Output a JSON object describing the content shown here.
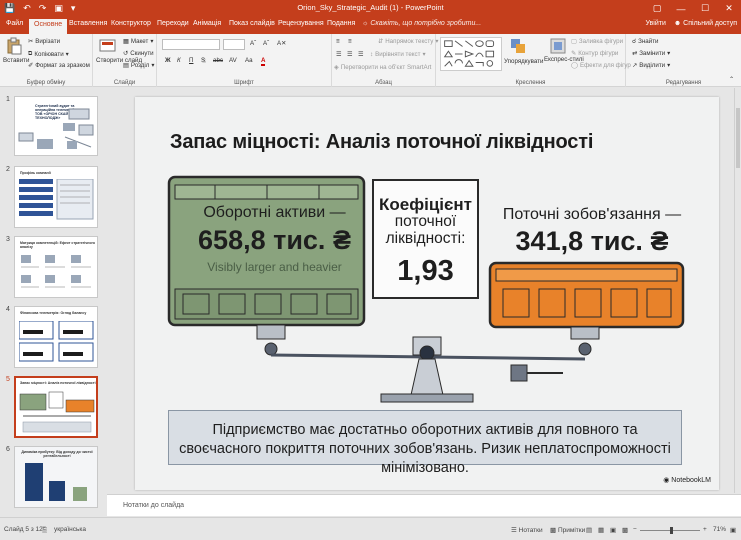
{
  "window": {
    "title": "Orion_Sky_Strategic_Audit (1) - PowerPoint",
    "controls": [
      "—",
      "☐",
      "✕"
    ]
  },
  "tabs": {
    "file": "Файл",
    "home": "Основне",
    "insert": "Вставлення",
    "design": "Конструктор",
    "transitions": "Переходи",
    "animations": "Анімація",
    "slideshow": "Показ слайдів",
    "review": "Рецензування",
    "view": "Подання",
    "tellme": "Скажіть, що потрібно зробити...",
    "signin": "Увійти",
    "share": "Спільний доступ"
  },
  "ribbon": {
    "clipboard": {
      "paste": "Вставити",
      "cut": "Вирізати",
      "copy": "Копіювати",
      "format_painter": "Формат за зразком",
      "label": "Буфер обміну"
    },
    "slides": {
      "new_slide": "Створити слайд",
      "layout": "Макет",
      "reset": "Скинути",
      "section": "Розділ",
      "label": "Слайди"
    },
    "font": {
      "label": "Шрифт",
      "buttons": [
        "Ж",
        "К",
        "П",
        "S",
        "abc",
        "AV",
        "Aa",
        "A"
      ]
    },
    "paragraph": {
      "text_direction": "Напрямок тексту",
      "align_text": "Вирівняти текст",
      "smartart": "Перетворити на об'єкт SmartArt",
      "label": "Абзац"
    },
    "drawing": {
      "arrange": "Упорядкувати",
      "quick_styles": "Експрес-стилі",
      "fill": "Заливка фігури",
      "outline": "Контур фігури",
      "effects": "Ефекти для фігур",
      "label": "Креслення"
    },
    "editing": {
      "find": "Знайти",
      "replace": "Замінити",
      "select": "Виділити",
      "label": "Редагування"
    }
  },
  "thumbnails": [
    {
      "number": "1",
      "text": "Стратегічний аудит та операційна телеметрія: ТОВ «ОРІОН СКАЙ ТЕХНОЛОДЖ»"
    },
    {
      "number": "2",
      "text": "Профіль компанії"
    },
    {
      "number": "3",
      "text": "Матриця компетенцій: Ефект стратегічного аналізу"
    },
    {
      "number": "4",
      "text": "Фінансова телеметрія: Огляд балансу"
    },
    {
      "number": "5",
      "text": "Запас міцності: Аналіз поточної ліквідності"
    },
    {
      "number": "6",
      "text": "Динаміка прибутку: Від доходу до чистої рентабельності"
    }
  ],
  "slide": {
    "title": "Запас міцності: Аналіз поточної ліквідності",
    "left": {
      "label": "Оборотні активи —",
      "value": "658,8 тис. ₴",
      "note": "Visibly larger and heavier"
    },
    "ratio": {
      "label_1": "Коефіцієнт",
      "label_2": "поточної",
      "label_3": "ліквідності:",
      "value": "1,93"
    },
    "right": {
      "label": "Поточні зобов'язання —",
      "value": "341,8 тис. ₴"
    },
    "callout": "Підприємство має достатньо оборотних активів для повного та своєчасного покриття поточних зобов'язань. Ризик неплатоспроможності мінімізовано.",
    "brand": "NotebookLM"
  },
  "notes_placeholder": "Нотатки до слайда",
  "status": {
    "slide_counter": "Слайд 5 з 12",
    "language": "українська",
    "notes": "Нотатки",
    "comments": "Примітки",
    "zoom": "71%"
  },
  "colors": {
    "accent": "#c43e1c",
    "asset_green": "#8aa37e",
    "liability_orange": "#e8822a",
    "selected_border": "#c43e1c"
  }
}
